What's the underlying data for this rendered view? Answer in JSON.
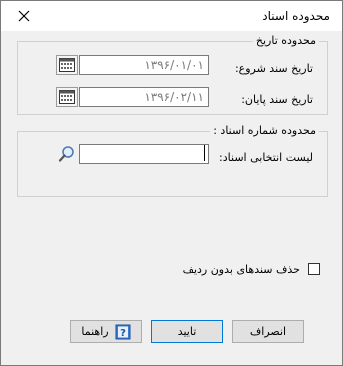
{
  "window": {
    "title": "محدوده اسناد"
  },
  "date_group": {
    "title": "محدوده تاریخ",
    "start_label": "تاریخ سند شروع:",
    "start_value": "۱۳۹۶/۰۱/۰۱",
    "end_label": "تاریخ سند پایان:",
    "end_value": "۱۳۹۶/۰۲/۱۱"
  },
  "number_group": {
    "title": "محدوده شماره اسناد :",
    "list_label": "لیست انتخابی اسناد:",
    "list_value": ""
  },
  "options": {
    "delete_empty_label": "حذف سندهای بدون ردیف",
    "delete_empty_checked": false
  },
  "buttons": {
    "cancel": "انصراف",
    "ok": "تایید",
    "help": "راهنما"
  },
  "icons": {
    "close": "close-icon",
    "calendar": "calendar-icon",
    "search": "magnifier-icon",
    "help": "help-book-icon"
  }
}
